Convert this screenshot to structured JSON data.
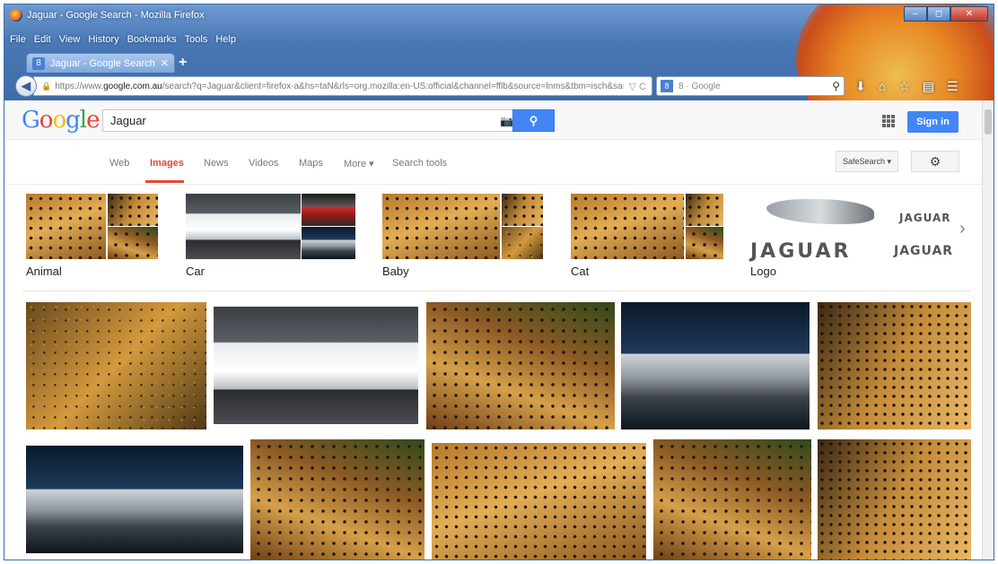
{
  "window": {
    "title": "Jaguar - Google Search - Mozilla Firefox",
    "controls": [
      "–",
      "◻",
      "✕"
    ]
  },
  "menu": [
    "File",
    "Edit",
    "View",
    "History",
    "Bookmarks",
    "Tools",
    "Help"
  ],
  "tab": {
    "label": "Jaguar - Google Search",
    "favicon": "8",
    "close": "✕",
    "new_tab": "+"
  },
  "address": {
    "prefix": "https://www.",
    "host": "google.com.au",
    "rest": "/search?q=Jaguar&client=firefox-a&hs=taN&rls=org.mozilla:en-US:official&channel=fflb&source=lnms&tbm=isch&sa=X&ei",
    "tools": "▽ C"
  },
  "searchbar": {
    "engine": "8",
    "placeholder": "8 · Google"
  },
  "google": {
    "logo": [
      "G",
      "o",
      "o",
      "g",
      "l",
      "e"
    ],
    "query": "Jaguar",
    "sign_in": "Sign in",
    "nav": [
      "Web",
      "Images",
      "News",
      "Videos",
      "Maps",
      "More ▾",
      "Search tools"
    ],
    "active_nav": "Images",
    "safesearch": "SafeSearch ▾"
  },
  "related": [
    {
      "label": "Animal"
    },
    {
      "label": "Car"
    },
    {
      "label": "Baby"
    },
    {
      "label": "Cat"
    },
    {
      "label": "Logo",
      "logo_text": [
        "JAGUAR",
        "JAGUAR",
        "JAGUAR"
      ]
    }
  ],
  "results": {
    "row1": [
      "jaguar roaring",
      "white jaguar sedan",
      "jaguar walking",
      "silver concept car",
      "jaguar portrait"
    ],
    "row2": [
      "silver concept car",
      "jaguar lying on log",
      "jaguar lying",
      "jaguar in forest",
      "jaguar face"
    ]
  }
}
